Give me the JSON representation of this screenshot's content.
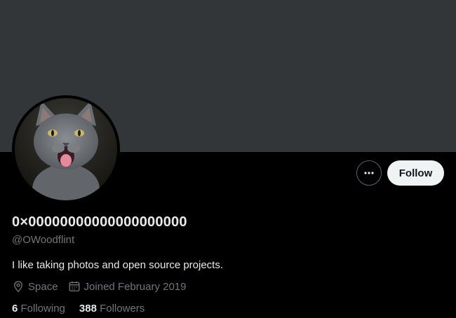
{
  "profile": {
    "display_name": "0×00000000000000000000",
    "handle": "@OWoodflint",
    "bio": "I like taking photos and open source projects.",
    "location": "Space",
    "joined": "Joined February 2019",
    "following_count": "6",
    "following_label": "Following",
    "followers_count": "388",
    "followers_label": "Followers"
  },
  "actions": {
    "more_icon": "more-dots-icon",
    "follow_label": "Follow"
  },
  "icons": {
    "location": "location-pin-icon",
    "calendar": "calendar-icon"
  },
  "colors": {
    "background": "#000000",
    "banner": "#333639",
    "primary_text": "#e7e9ea",
    "secondary_text": "#71767b",
    "follow_bg": "#eff3f4"
  }
}
